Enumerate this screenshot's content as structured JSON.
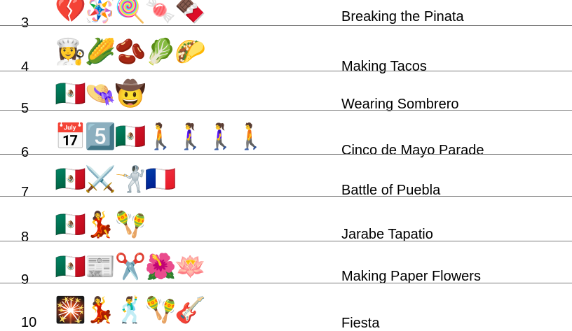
{
  "rows": [
    {
      "number": "3",
      "emoji": "💔🪅🍭🍬🍫",
      "answer": "Breaking the Pinata"
    },
    {
      "number": "4",
      "emoji": "👩‍🍳🌽🫘🥬🌮",
      "answer": "Making Tacos"
    },
    {
      "number": "5",
      "emoji": "🇲🇽👒🤠",
      "answer": "Wearing Sombrero"
    },
    {
      "number": "6",
      "emoji": "📅5️⃣🇲🇽🚶🚶‍♀️🚶‍♀️🚶",
      "answer": "Cinco de Mayo Parade"
    },
    {
      "number": "7",
      "emoji": "🇲🇽⚔️🤺🇫🇷",
      "answer": "Battle of Puebla"
    },
    {
      "number": "8",
      "emoji": "🇲🇽💃🪇",
      "answer": "Jarabe Tapatio"
    },
    {
      "number": "9",
      "emoji": "🇲🇽📰✂️🌺🪷",
      "answer": "Making Paper Flowers"
    },
    {
      "number": "10",
      "emoji": "🎇💃🕺🪇🎸",
      "answer": "Fiesta"
    }
  ]
}
